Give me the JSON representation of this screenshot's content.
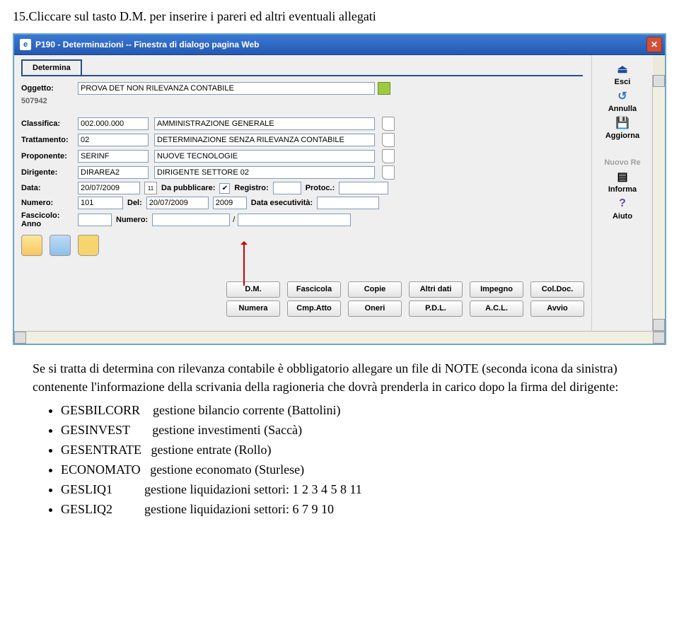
{
  "intro": "15.Cliccare sul tasto D.M. per inserire i pareri ed altri eventuali allegati",
  "titlebar": "P190 - Determinazioni -- Finestra di dialogo pagina Web",
  "tab_label": "Determina",
  "panel": {
    "labels": {
      "oggetto": "Oggetto:",
      "codice_lbl": "507942",
      "classifica": "Classifica:",
      "trattamento": "Trattamento:",
      "proponente": "Proponente:",
      "dirigente": "Dirigente:",
      "data": "Data:",
      "numero": "Numero:",
      "fascicolo": "Fascicolo:  Anno",
      "da_pubblicare": "Da pubblicare:",
      "registro": "Registro:",
      "protoc": "Protoc.:",
      "del": "Del:",
      "data_esec": "Data esecutività:",
      "numero2": "Numero:"
    },
    "values": {
      "oggetto_val": "PROVA DET NON RILEVANZA CONTABILE",
      "classifica_code": "002.000.000",
      "classifica_desc": "AMMINISTRAZIONE GENERALE",
      "trattamento_code": "02",
      "trattamento_desc": "DETERMINAZIONE SENZA RILEVANZA CONTABILE",
      "proponente_code": "SERINF",
      "proponente_desc": "NUOVE TECNOLOGIE",
      "dirigente_code": "DIRAREA2",
      "dirigente_desc": "DIRIGENTE SETTORE 02",
      "data": "20/07/2009",
      "numero": "101",
      "del": "20/07/2009",
      "year": "2009",
      "check": "✔"
    }
  },
  "bottom_buttons": {
    "r1": [
      "D.M.",
      "Fascicola",
      "Copie",
      "Altri dati",
      "Impegno",
      "Col.Doc."
    ],
    "r2": [
      "Numera",
      "Cmp.Atto",
      "Oneri",
      "P.D.L.",
      "A.C.L.",
      "Avvio"
    ]
  },
  "right_panel": [
    {
      "icon": "⏏",
      "label": "Esci"
    },
    {
      "icon": "↺",
      "label": "Annulla"
    },
    {
      "icon": "💾",
      "label": "Aggiorna"
    },
    {
      "icon": " ",
      "label": "Nuovo Re",
      "grey": true
    },
    {
      "icon": "▤",
      "label": "Informa"
    },
    {
      "icon": "?",
      "label": "Aiuto"
    }
  ],
  "post": {
    "para": "Se si tratta di determina con rilevanza contabile è obbligatorio allegare un file di NOTE (seconda icona da sinistra) contenente l'informazione della scrivania della ragioneria che dovrà prenderla in carico dopo la firma del dirigente:",
    "items": [
      {
        "k": "GESBILCORR",
        "v": "gestione bilancio corrente (Battolini)"
      },
      {
        "k": "GESINVEST",
        "v": "gestione investimenti      (Saccà)"
      },
      {
        "k": "GESENTRATE",
        "v": "gestione entrate              (Rollo)"
      },
      {
        "k": "ECONOMATO",
        "v": "gestione economato        (Sturlese)"
      },
      {
        "k": "GESLIQ1",
        "v": "gestione liquidazioni settori:  1 2 3 4 5 8 11"
      },
      {
        "k": "GESLIQ2",
        "v": "gestione liquidazioni settori:  6 7 9 10"
      }
    ]
  }
}
